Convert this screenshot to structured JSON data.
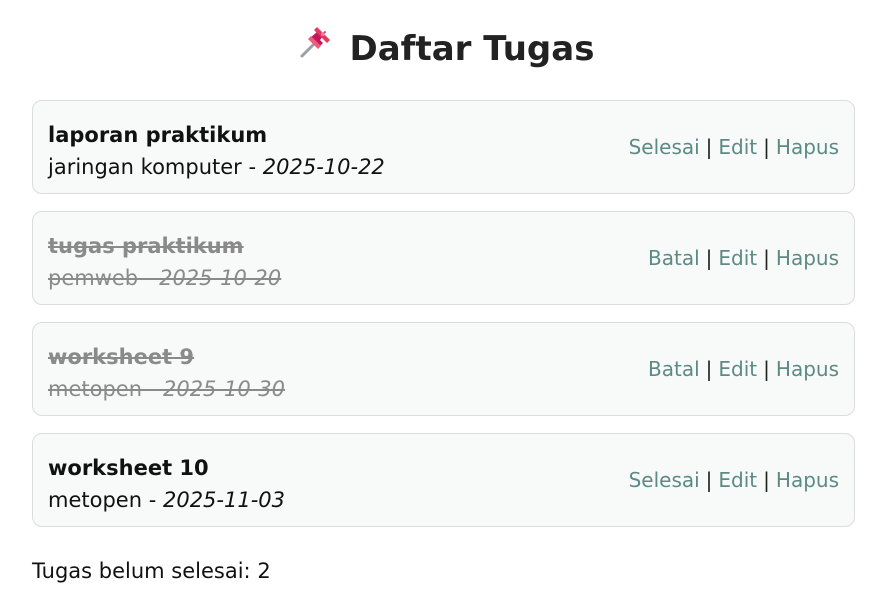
{
  "header": {
    "icon": "pushpin-icon",
    "title": "Daftar Tugas"
  },
  "colors": {
    "link": "#5c8a84",
    "done_text": "#8a8a8a",
    "card_bg": "#f8f9f9",
    "card_border": "#dcdcdc"
  },
  "tasks": [
    {
      "name": "laporan praktikum",
      "course": "jaringan komputer",
      "separator": " - ",
      "date": "2025-10-22",
      "done": false,
      "toggle_label": "Selesai",
      "edit_label": "Edit",
      "delete_label": "Hapus"
    },
    {
      "name": "tugas praktikum",
      "course": "pemweb",
      "separator": " - ",
      "date": "2025-10-20",
      "done": true,
      "toggle_label": "Batal",
      "edit_label": "Edit",
      "delete_label": "Hapus"
    },
    {
      "name": "worksheet 9",
      "course": "metopen",
      "separator": " - ",
      "date": "2025-10-30",
      "done": true,
      "toggle_label": "Batal",
      "edit_label": "Edit",
      "delete_label": "Hapus"
    },
    {
      "name": "worksheet 10",
      "course": "metopen",
      "separator": " - ",
      "date": "2025-11-03",
      "done": false,
      "toggle_label": "Selesai",
      "edit_label": "Edit",
      "delete_label": "Hapus"
    }
  ],
  "action_separator": "|",
  "footer": {
    "label": "Tugas belum selesai:",
    "count": "2"
  }
}
